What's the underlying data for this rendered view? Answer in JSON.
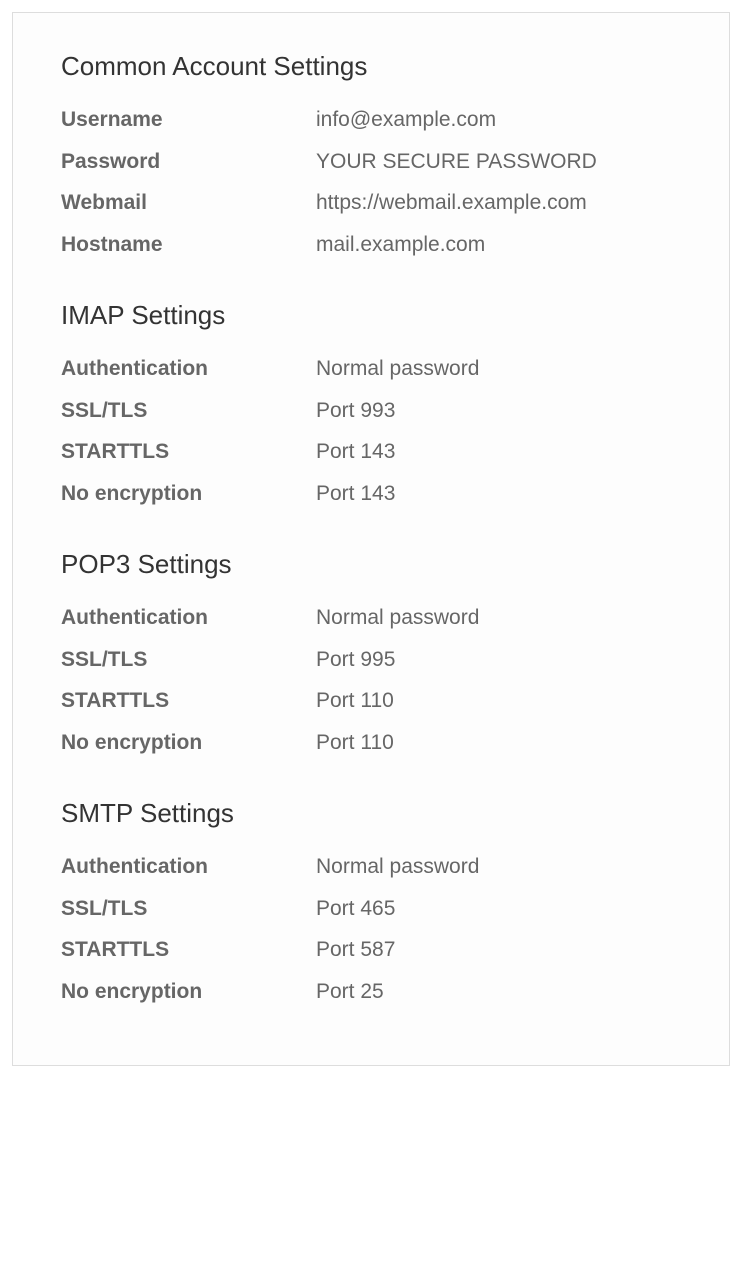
{
  "common": {
    "heading": "Common Account Settings",
    "rows": {
      "username": {
        "label": "Username",
        "value": "info@example.com"
      },
      "password": {
        "label": "Password",
        "value": "YOUR SECURE PASSWORD"
      },
      "webmail": {
        "label": "Webmail",
        "value": "https://webmail.example.com"
      },
      "hostname": {
        "label": "Hostname",
        "value": "mail.example.com"
      }
    }
  },
  "imap": {
    "heading": "IMAP Settings",
    "rows": {
      "auth": {
        "label": "Authentication",
        "value": "Normal password"
      },
      "ssltls": {
        "label": "SSL/TLS",
        "value": "Port 993"
      },
      "starttls": {
        "label": "STARTTLS",
        "value": "Port 143"
      },
      "noenc": {
        "label": "No encryption",
        "value": "Port 143"
      }
    }
  },
  "pop3": {
    "heading": "POP3 Settings",
    "rows": {
      "auth": {
        "label": "Authentication",
        "value": "Normal password"
      },
      "ssltls": {
        "label": "SSL/TLS",
        "value": "Port 995"
      },
      "starttls": {
        "label": "STARTTLS",
        "value": "Port 110"
      },
      "noenc": {
        "label": "No encryption",
        "value": "Port 110"
      }
    }
  },
  "smtp": {
    "heading": "SMTP Settings",
    "rows": {
      "auth": {
        "label": "Authentication",
        "value": "Normal password"
      },
      "ssltls": {
        "label": "SSL/TLS",
        "value": "Port 465"
      },
      "starttls": {
        "label": "STARTTLS",
        "value": "Port 587"
      },
      "noenc": {
        "label": "No encryption",
        "value": "Port 25"
      }
    }
  }
}
